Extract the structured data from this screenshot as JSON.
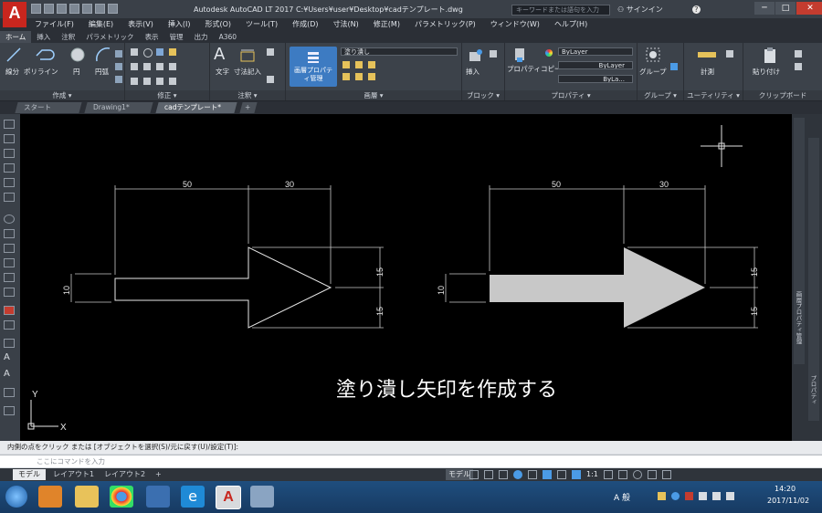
{
  "app": {
    "logo": "A",
    "title": "Autodesk AutoCAD LT 2017    C:¥Users¥user¥Desktop¥cadテンプレート.dwg",
    "search_placeholder": "キーワードまたは語句を入力",
    "signin": "サインイン"
  },
  "window_controls": [
    "─",
    "□",
    "✕"
  ],
  "menu": [
    "ファイル(F)",
    "編集(E)",
    "表示(V)",
    "挿入(I)",
    "形式(O)",
    "ツール(T)",
    "作成(D)",
    "寸法(N)",
    "修正(M)",
    "パラメトリック(P)",
    "ウィンドウ(W)",
    "ヘルプ(H)"
  ],
  "ribbon_tabs": [
    "ホーム",
    "挿入",
    "注釈",
    "パラメトリック",
    "表示",
    "管理",
    "出力",
    "A360"
  ],
  "ribbon": {
    "draw": {
      "line": "線分",
      "polyline": "ポリライン",
      "circle": "円",
      "arc": "円弧",
      "footer": "作成 ▾"
    },
    "modify": {
      "footer": "修正 ▾"
    },
    "annotation": {
      "text": "文字",
      "dimension": "寸法記入",
      "footer": "注釈 ▾"
    },
    "layers": {
      "props_button": "画層プロパティ管理",
      "layer_value": "塗り潰し",
      "footer": "画層 ▾"
    },
    "block": {
      "insert": "挿入",
      "footer": "ブロック ▾"
    },
    "properties": {
      "copy": "プロパティコピー",
      "color": "ByLayer",
      "linetype": "ByLayer",
      "lineweight": "ByLa...",
      "footer": "プロパティ ▾"
    },
    "groups": {
      "group": "グループ",
      "footer": "グループ ▾"
    },
    "utilities": {
      "measure": "計測",
      "footer": "ユーティリティ ▾"
    },
    "clipboard": {
      "paste": "貼り付け",
      "footer": "クリップボード"
    }
  },
  "doc_tabs": [
    "スタート",
    "Drawing1*",
    "cadテンプレート*",
    "+"
  ],
  "drawing": {
    "dims_left": {
      "top1": "50",
      "top2": "30",
      "left": "10",
      "right1": "15",
      "right2": "15"
    },
    "dims_right": {
      "top1": "50",
      "top2": "30",
      "left": "10",
      "right1": "15",
      "right2": "15"
    },
    "caption": "塗り潰し矢印を作成する",
    "ucs_x": "X",
    "ucs_y": "Y",
    "fill_color": "#c8c8c8"
  },
  "right_palette": {
    "label1": "画層プロパティ管理",
    "label2": "プロパティ"
  },
  "command": {
    "history": "内側の点をクリック または [オブジェクトを選択(S)/元に戻す(U)/設定(T)]:",
    "placeholder": "ここにコマンドを入力"
  },
  "layout_tabs": [
    "モデル",
    "レイアウト1",
    "レイアウト2",
    "+"
  ],
  "status": {
    "model": "モデル",
    "scale": "1:1"
  },
  "taskbar": {
    "time": "14:20",
    "date": "2017/11/02",
    "ime": "A 般"
  }
}
